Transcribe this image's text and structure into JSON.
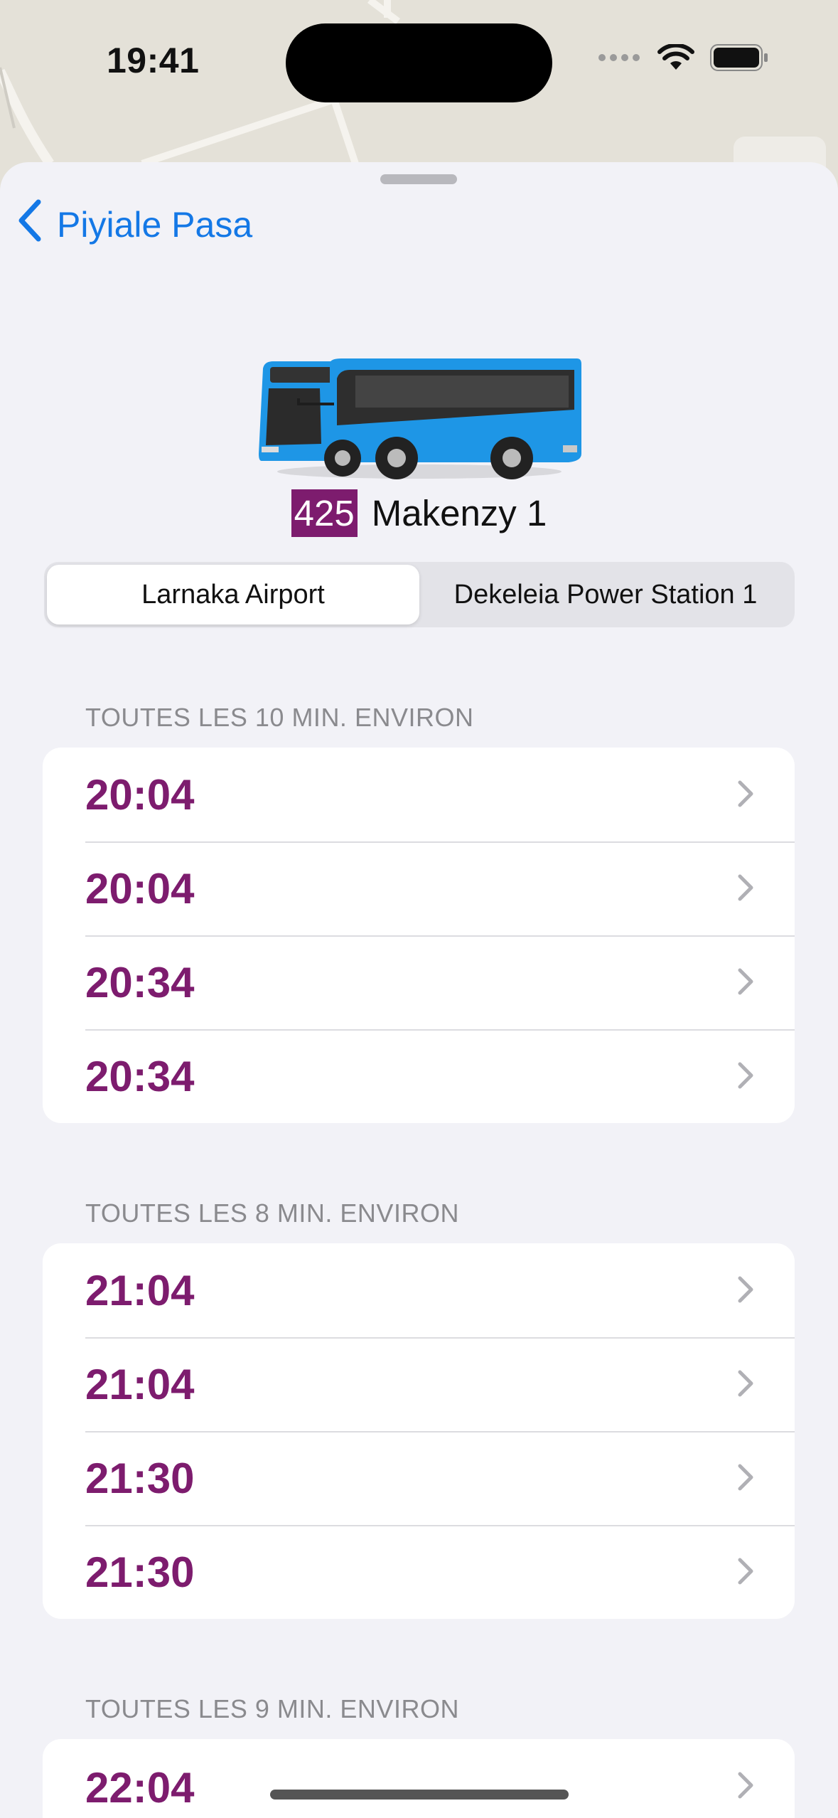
{
  "status": {
    "time": "19:41"
  },
  "nav": {
    "back_label": "Piyiale Pasa"
  },
  "route": {
    "number": "425",
    "name": "Makenzy 1"
  },
  "directions": [
    "Larnaka Airport",
    "Dekeleia Power Station 1"
  ],
  "selected_direction": "Larnaka Airport",
  "sections": [
    {
      "header": "TOUTES LES 10 MIN. ENVIRON",
      "times": [
        "20:04",
        "20:04",
        "20:34",
        "20:34"
      ]
    },
    {
      "header": "TOUTES LES 8 MIN. ENVIRON",
      "times": [
        "21:04",
        "21:04",
        "21:30",
        "21:30"
      ]
    },
    {
      "header": "TOUTES LES 9 MIN. ENVIRON",
      "times": [
        "22:04"
      ]
    }
  ],
  "colors": {
    "accent": "#1478e6",
    "route": "#7d1c6e",
    "bus_body": "#1e96e6"
  },
  "icons": [
    "wifi-icon",
    "battery-icon",
    "cellular-icon",
    "chevron-left-icon",
    "chevron-right-icon",
    "bus-icon"
  ]
}
